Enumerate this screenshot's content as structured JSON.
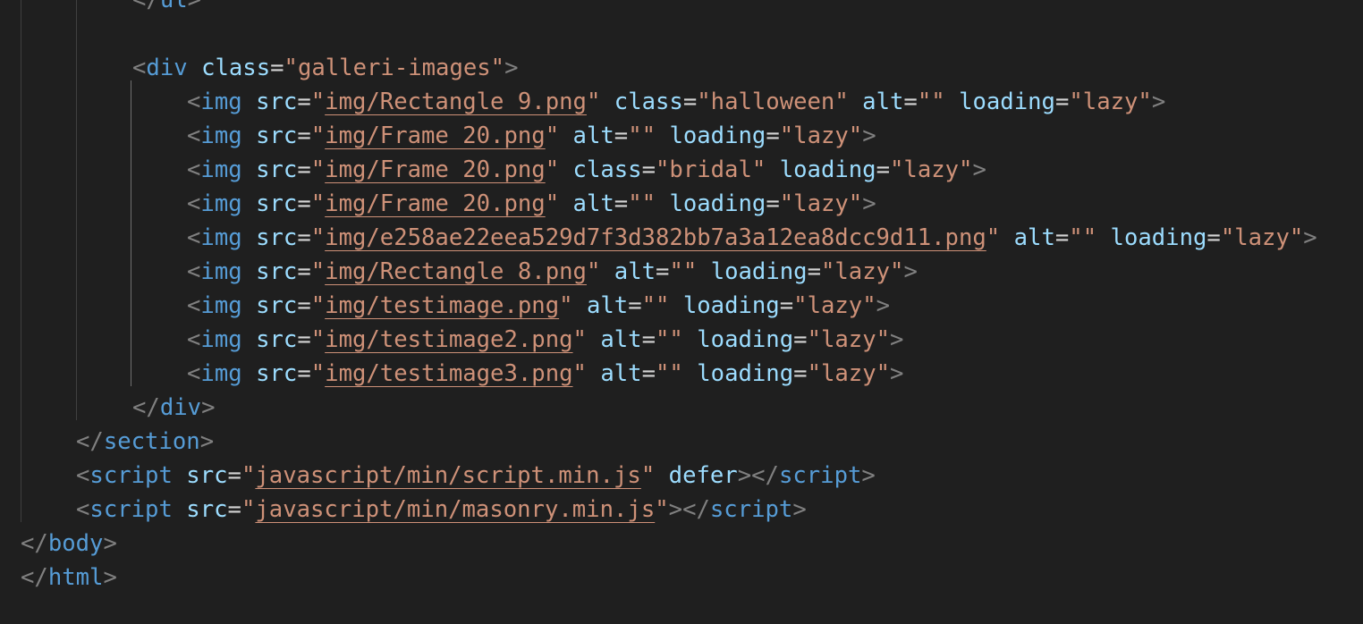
{
  "editor": {
    "theme_colors": {
      "background": "#1f1f1f",
      "punctuation": "#808080",
      "tag": "#569cd6",
      "attribute": "#9cdcfe",
      "string": "#ce9178",
      "text": "#d4d4d4",
      "indent_guide": "#404040"
    },
    "lines": [
      {
        "tokens": [
          {
            "t": "</",
            "k": "punct"
          },
          {
            "t": "ul",
            "k": "tag"
          },
          {
            "t": ">",
            "k": "punct"
          }
        ]
      },
      {
        "tokens": []
      },
      {
        "tokens": [
          {
            "t": "<",
            "k": "punct"
          },
          {
            "t": "div",
            "k": "tag"
          },
          {
            "t": " ",
            "k": "text"
          },
          {
            "t": "class",
            "k": "attr"
          },
          {
            "t": "=",
            "k": "eq"
          },
          {
            "t": "\"galleri-images\"",
            "k": "str"
          },
          {
            "t": ">",
            "k": "punct"
          }
        ]
      },
      {
        "tokens": [
          {
            "t": "<",
            "k": "punct"
          },
          {
            "t": "img",
            "k": "tag"
          },
          {
            "t": " ",
            "k": "text"
          },
          {
            "t": "src",
            "k": "attr"
          },
          {
            "t": "=",
            "k": "eq"
          },
          {
            "t": "\"",
            "k": "str"
          },
          {
            "t": "img/Rectangle 9.png",
            "k": "link"
          },
          {
            "t": "\"",
            "k": "str"
          },
          {
            "t": " ",
            "k": "text"
          },
          {
            "t": "class",
            "k": "attr"
          },
          {
            "t": "=",
            "k": "eq"
          },
          {
            "t": "\"halloween\"",
            "k": "str"
          },
          {
            "t": " ",
            "k": "text"
          },
          {
            "t": "alt",
            "k": "attr"
          },
          {
            "t": "=",
            "k": "eq"
          },
          {
            "t": "\"\"",
            "k": "str"
          },
          {
            "t": " ",
            "k": "text"
          },
          {
            "t": "loading",
            "k": "attr"
          },
          {
            "t": "=",
            "k": "eq"
          },
          {
            "t": "\"lazy\"",
            "k": "str"
          },
          {
            "t": ">",
            "k": "punct"
          }
        ]
      },
      {
        "tokens": [
          {
            "t": "<",
            "k": "punct"
          },
          {
            "t": "img",
            "k": "tag"
          },
          {
            "t": " ",
            "k": "text"
          },
          {
            "t": "src",
            "k": "attr"
          },
          {
            "t": "=",
            "k": "eq"
          },
          {
            "t": "\"",
            "k": "str"
          },
          {
            "t": "img/Frame 20.png",
            "k": "link"
          },
          {
            "t": "\"",
            "k": "str"
          },
          {
            "t": " ",
            "k": "text"
          },
          {
            "t": "alt",
            "k": "attr"
          },
          {
            "t": "=",
            "k": "eq"
          },
          {
            "t": "\"\"",
            "k": "str"
          },
          {
            "t": " ",
            "k": "text"
          },
          {
            "t": "loading",
            "k": "attr"
          },
          {
            "t": "=",
            "k": "eq"
          },
          {
            "t": "\"lazy\"",
            "k": "str"
          },
          {
            "t": ">",
            "k": "punct"
          }
        ]
      },
      {
        "tokens": [
          {
            "t": "<",
            "k": "punct"
          },
          {
            "t": "img",
            "k": "tag"
          },
          {
            "t": " ",
            "k": "text"
          },
          {
            "t": "src",
            "k": "attr"
          },
          {
            "t": "=",
            "k": "eq"
          },
          {
            "t": "\"",
            "k": "str"
          },
          {
            "t": "img/Frame 20.png",
            "k": "link"
          },
          {
            "t": "\"",
            "k": "str"
          },
          {
            "t": " ",
            "k": "text"
          },
          {
            "t": "class",
            "k": "attr"
          },
          {
            "t": "=",
            "k": "eq"
          },
          {
            "t": "\"bridal\"",
            "k": "str"
          },
          {
            "t": " ",
            "k": "text"
          },
          {
            "t": "loading",
            "k": "attr"
          },
          {
            "t": "=",
            "k": "eq"
          },
          {
            "t": "\"lazy\"",
            "k": "str"
          },
          {
            "t": ">",
            "k": "punct"
          }
        ]
      },
      {
        "tokens": [
          {
            "t": "<",
            "k": "punct"
          },
          {
            "t": "img",
            "k": "tag"
          },
          {
            "t": " ",
            "k": "text"
          },
          {
            "t": "src",
            "k": "attr"
          },
          {
            "t": "=",
            "k": "eq"
          },
          {
            "t": "\"",
            "k": "str"
          },
          {
            "t": "img/Frame 20.png",
            "k": "link"
          },
          {
            "t": "\"",
            "k": "str"
          },
          {
            "t": " ",
            "k": "text"
          },
          {
            "t": "alt",
            "k": "attr"
          },
          {
            "t": "=",
            "k": "eq"
          },
          {
            "t": "\"\"",
            "k": "str"
          },
          {
            "t": " ",
            "k": "text"
          },
          {
            "t": "loading",
            "k": "attr"
          },
          {
            "t": "=",
            "k": "eq"
          },
          {
            "t": "\"lazy\"",
            "k": "str"
          },
          {
            "t": ">",
            "k": "punct"
          }
        ]
      },
      {
        "tokens": [
          {
            "t": "<",
            "k": "punct"
          },
          {
            "t": "img",
            "k": "tag"
          },
          {
            "t": " ",
            "k": "text"
          },
          {
            "t": "src",
            "k": "attr"
          },
          {
            "t": "=",
            "k": "eq"
          },
          {
            "t": "\"",
            "k": "str"
          },
          {
            "t": "img/e258ae22eea529d7f3d382bb7a3a12ea8dcc9d11.png",
            "k": "link"
          },
          {
            "t": "\"",
            "k": "str"
          },
          {
            "t": " ",
            "k": "text"
          },
          {
            "t": "alt",
            "k": "attr"
          },
          {
            "t": "=",
            "k": "eq"
          },
          {
            "t": "\"\"",
            "k": "str"
          },
          {
            "t": " ",
            "k": "text"
          },
          {
            "t": "loading",
            "k": "attr"
          },
          {
            "t": "=",
            "k": "eq"
          },
          {
            "t": "\"lazy\"",
            "k": "str"
          },
          {
            "t": ">",
            "k": "punct"
          }
        ]
      },
      {
        "tokens": [
          {
            "t": "<",
            "k": "punct"
          },
          {
            "t": "img",
            "k": "tag"
          },
          {
            "t": " ",
            "k": "text"
          },
          {
            "t": "src",
            "k": "attr"
          },
          {
            "t": "=",
            "k": "eq"
          },
          {
            "t": "\"",
            "k": "str"
          },
          {
            "t": "img/Rectangle 8.png",
            "k": "link"
          },
          {
            "t": "\"",
            "k": "str"
          },
          {
            "t": " ",
            "k": "text"
          },
          {
            "t": "alt",
            "k": "attr"
          },
          {
            "t": "=",
            "k": "eq"
          },
          {
            "t": "\"\"",
            "k": "str"
          },
          {
            "t": " ",
            "k": "text"
          },
          {
            "t": "loading",
            "k": "attr"
          },
          {
            "t": "=",
            "k": "eq"
          },
          {
            "t": "\"lazy\"",
            "k": "str"
          },
          {
            "t": ">",
            "k": "punct"
          }
        ]
      },
      {
        "tokens": [
          {
            "t": "<",
            "k": "punct"
          },
          {
            "t": "img",
            "k": "tag"
          },
          {
            "t": " ",
            "k": "text"
          },
          {
            "t": "src",
            "k": "attr"
          },
          {
            "t": "=",
            "k": "eq"
          },
          {
            "t": "\"",
            "k": "str"
          },
          {
            "t": "img/testimage.png",
            "k": "link"
          },
          {
            "t": "\"",
            "k": "str"
          },
          {
            "t": " ",
            "k": "text"
          },
          {
            "t": "alt",
            "k": "attr"
          },
          {
            "t": "=",
            "k": "eq"
          },
          {
            "t": "\"\"",
            "k": "str"
          },
          {
            "t": " ",
            "k": "text"
          },
          {
            "t": "loading",
            "k": "attr"
          },
          {
            "t": "=",
            "k": "eq"
          },
          {
            "t": "\"lazy\"",
            "k": "str"
          },
          {
            "t": ">",
            "k": "punct"
          }
        ]
      },
      {
        "tokens": [
          {
            "t": "<",
            "k": "punct"
          },
          {
            "t": "img",
            "k": "tag"
          },
          {
            "t": " ",
            "k": "text"
          },
          {
            "t": "src",
            "k": "attr"
          },
          {
            "t": "=",
            "k": "eq"
          },
          {
            "t": "\"",
            "k": "str"
          },
          {
            "t": "img/testimage2.png",
            "k": "link"
          },
          {
            "t": "\"",
            "k": "str"
          },
          {
            "t": " ",
            "k": "text"
          },
          {
            "t": "alt",
            "k": "attr"
          },
          {
            "t": "=",
            "k": "eq"
          },
          {
            "t": "\"\"",
            "k": "str"
          },
          {
            "t": " ",
            "k": "text"
          },
          {
            "t": "loading",
            "k": "attr"
          },
          {
            "t": "=",
            "k": "eq"
          },
          {
            "t": "\"lazy\"",
            "k": "str"
          },
          {
            "t": ">",
            "k": "punct"
          }
        ]
      },
      {
        "tokens": [
          {
            "t": "<",
            "k": "punct"
          },
          {
            "t": "img",
            "k": "tag"
          },
          {
            "t": " ",
            "k": "text"
          },
          {
            "t": "src",
            "k": "attr"
          },
          {
            "t": "=",
            "k": "eq"
          },
          {
            "t": "\"",
            "k": "str"
          },
          {
            "t": "img/testimage3.png",
            "k": "link"
          },
          {
            "t": "\"",
            "k": "str"
          },
          {
            "t": " ",
            "k": "text"
          },
          {
            "t": "alt",
            "k": "attr"
          },
          {
            "t": "=",
            "k": "eq"
          },
          {
            "t": "\"\"",
            "k": "str"
          },
          {
            "t": " ",
            "k": "text"
          },
          {
            "t": "loading",
            "k": "attr"
          },
          {
            "t": "=",
            "k": "eq"
          },
          {
            "t": "\"lazy\"",
            "k": "str"
          },
          {
            "t": ">",
            "k": "punct"
          }
        ]
      },
      {
        "tokens": [
          {
            "t": "</",
            "k": "punct"
          },
          {
            "t": "div",
            "k": "tag"
          },
          {
            "t": ">",
            "k": "punct"
          }
        ]
      },
      {
        "tokens": [
          {
            "t": "</",
            "k": "punct"
          },
          {
            "t": "section",
            "k": "tag"
          },
          {
            "t": ">",
            "k": "punct"
          }
        ]
      },
      {
        "tokens": [
          {
            "t": "<",
            "k": "punct"
          },
          {
            "t": "script",
            "k": "tag"
          },
          {
            "t": " ",
            "k": "text"
          },
          {
            "t": "src",
            "k": "attr"
          },
          {
            "t": "=",
            "k": "eq"
          },
          {
            "t": "\"",
            "k": "str"
          },
          {
            "t": "javascript/min/script.min.js",
            "k": "link"
          },
          {
            "t": "\"",
            "k": "str"
          },
          {
            "t": " ",
            "k": "text"
          },
          {
            "t": "defer",
            "k": "attr"
          },
          {
            "t": "></",
            "k": "punct"
          },
          {
            "t": "script",
            "k": "tag"
          },
          {
            "t": ">",
            "k": "punct"
          }
        ]
      },
      {
        "tokens": [
          {
            "t": "<",
            "k": "punct"
          },
          {
            "t": "script",
            "k": "tag"
          },
          {
            "t": " ",
            "k": "text"
          },
          {
            "t": "src",
            "k": "attr"
          },
          {
            "t": "=",
            "k": "eq"
          },
          {
            "t": "\"",
            "k": "str"
          },
          {
            "t": "javascript/min/masonry.min.js",
            "k": "link"
          },
          {
            "t": "\"",
            "k": "str"
          },
          {
            "t": "></",
            "k": "punct"
          },
          {
            "t": "script",
            "k": "tag"
          },
          {
            "t": ">",
            "k": "punct"
          }
        ]
      },
      {
        "tokens": [
          {
            "t": "</",
            "k": "punct"
          },
          {
            "t": "body",
            "k": "tag"
          },
          {
            "t": ">",
            "k": "punct"
          }
        ]
      },
      {
        "tokens": [
          {
            "t": "</",
            "k": "punct"
          },
          {
            "t": "html",
            "k": "tag"
          },
          {
            "t": ">",
            "k": "punct"
          }
        ]
      }
    ]
  }
}
